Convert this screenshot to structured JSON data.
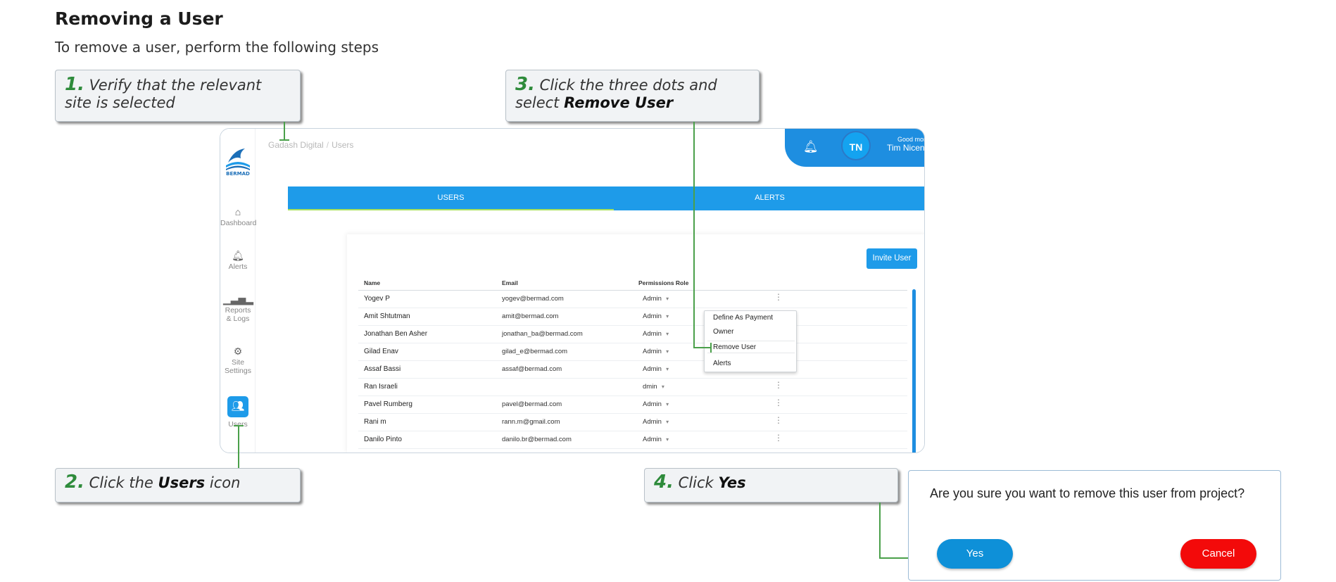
{
  "doc": {
    "title": "Removing a User",
    "subtitle": "To remove a user, perform the following steps"
  },
  "steps": [
    {
      "num": "1.",
      "text": "Verify that the relevant site is selected"
    },
    {
      "num": "2.",
      "text_pre": "Click the",
      "bold": "Users",
      "text_post": "icon"
    },
    {
      "num": "3.",
      "text_pre": "Click the three dots and select",
      "bold": "Remove User"
    },
    {
      "num": "4.",
      "text_pre": "Click",
      "bold": "Yes"
    }
  ],
  "app": {
    "logo_text": "BERMAD",
    "breadcrumb": [
      "Gadash Digital",
      "Users"
    ],
    "sidebar": [
      {
        "label": "Dashboard",
        "icon": "home-icon"
      },
      {
        "label": "Alerts",
        "icon": "bell-icon"
      },
      {
        "label": "Reports & Logs",
        "icon": "bar-chart-icon"
      },
      {
        "label": "Site Settings",
        "icon": "gear-icon"
      },
      {
        "label": "Users",
        "icon": "users-icon"
      }
    ],
    "header": {
      "avatar_initials": "TN",
      "greeting": "Good morn",
      "user_name": "Tim Nicen"
    },
    "tabs": [
      "USERS",
      "ALERTS"
    ],
    "invite_button": "Invite User",
    "columns": [
      "Name",
      "Email",
      "Permissions Role"
    ],
    "rows": [
      {
        "name": "Yogev P",
        "email": "yogev@bermad.com",
        "role": "Admin"
      },
      {
        "name": "Amit Shtutman",
        "email": "amit@bermad.com",
        "role": "Admin"
      },
      {
        "name": "Jonathan Ben Asher",
        "email": "jonathan_ba@bermad.com",
        "role": "Admin"
      },
      {
        "name": "Gilad Enav",
        "email": "gilad_e@bermad.com",
        "role": "Admin"
      },
      {
        "name": "Assaf Bassi",
        "email": "assaf@bermad.com",
        "role": "Admin"
      },
      {
        "name": "Ran Israeli",
        "email": "",
        "role": "dmin"
      },
      {
        "name": "Pavel Rumberg",
        "email": "pavel@bermad.com",
        "role": "Admin"
      },
      {
        "name": "Rani m",
        "email": "rann.m@gmail.com",
        "role": "Admin"
      },
      {
        "name": "Danilo Pinto",
        "email": "danilo.br@bermad.com",
        "role": "Admin"
      }
    ],
    "context_menu": [
      "Define As Payment",
      "Owner",
      "Remove User",
      "Alerts"
    ]
  },
  "dialog": {
    "message": "Are you sure you want to remove this user from project?",
    "yes": "Yes",
    "cancel": "Cancel"
  },
  "colors": {
    "accent": "#1e9be9",
    "step_number": "#2e8b3b",
    "leader_line": "#4aa04a",
    "cancel": "#f30a0a"
  }
}
